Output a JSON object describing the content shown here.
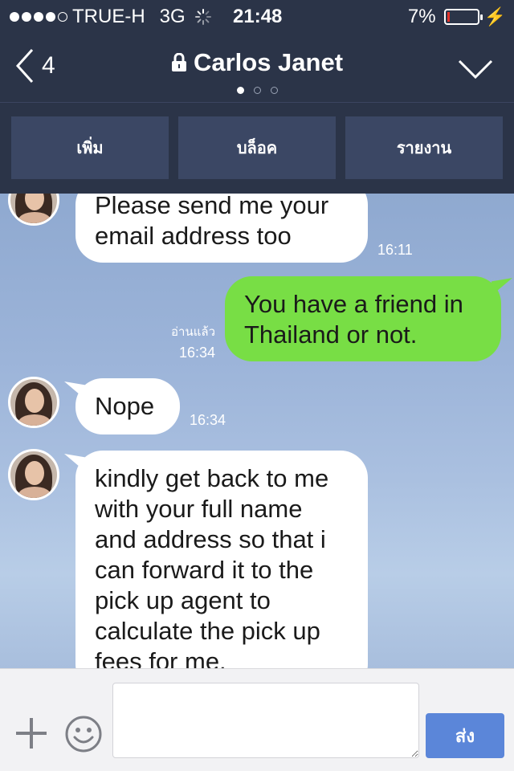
{
  "status_bar": {
    "carrier": "TRUE-H",
    "network": "3G",
    "time": "21:48",
    "battery": "7%",
    "battery_level": 0.07,
    "signal_bars_filled": 4,
    "signal_bars_total": 5
  },
  "nav": {
    "back_count": "4",
    "title": "Carlos Janet",
    "page_dots": 3,
    "active_dot": 0
  },
  "actions": {
    "add": "เพิ่ม",
    "block": "บล็อค",
    "report": "รายงาน"
  },
  "messages": [
    {
      "side": "in",
      "text_lines": [
        "Please send me your",
        "email address too"
      ],
      "time": "16:11"
    },
    {
      "side": "out",
      "text_lines": [
        "You have a friend in",
        "Thailand or not."
      ],
      "read": "อ่านแล้ว",
      "time": "16:34"
    },
    {
      "side": "in",
      "text_lines": [
        "Nope"
      ],
      "time": "16:34"
    },
    {
      "side": "in",
      "text_lines": [
        "kindly get back to me",
        "with your full name",
        "and address so that i",
        "can forward it to the",
        "pick up agent to",
        "calculate the pick up",
        "fees for me."
      ]
    }
  ],
  "input": {
    "value": "",
    "placeholder": "",
    "send_label": "ส่ง"
  },
  "colors": {
    "header_bg": "#2b3448",
    "action_btn_bg": "#3b4764",
    "outgoing_bubble": "#78de45",
    "incoming_bubble": "#ffffff",
    "send_button": "#5b86d9",
    "battery_low": "#e5332a"
  },
  "icons": [
    "signal-dots-icon",
    "loading-spinner-icon",
    "battery-icon",
    "charging-bolt-icon",
    "back-chevron-icon",
    "lock-icon",
    "chevron-down-icon",
    "plus-icon",
    "smiley-icon"
  ]
}
